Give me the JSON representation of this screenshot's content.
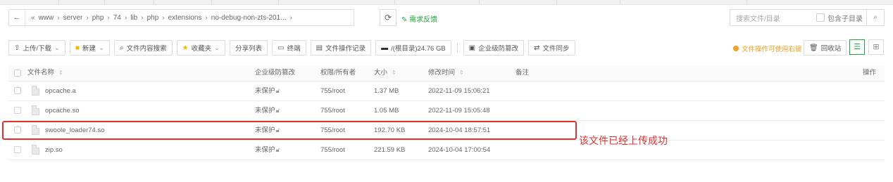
{
  "path": {
    "back_icon": "arrow-left-icon",
    "crumbs": [
      "«",
      "www",
      "server",
      "php",
      "74",
      "lib",
      "php",
      "extensions",
      "no-debug-non-zts-201..."
    ],
    "refresh_icon": "refresh-icon",
    "feedback_label": "需求反馈"
  },
  "search": {
    "placeholder": "搜索文件/目录",
    "include_subdir_label": "包含子目录"
  },
  "toolbar": {
    "upload_label": "上传/下载",
    "new_label": "新建",
    "content_search_label": "文件内容搜索",
    "favorites_label": "收藏夹",
    "share_list_label": "分享列表",
    "terminal_label": "终端",
    "op_log_label": "文件操作记录",
    "disk_label": "/(根目录)24.76 GB",
    "tamper_label": "企业级防篡改",
    "sync_label": "文件同步",
    "hint_label": "文件操作可使用右键",
    "recycle_label": "回收站"
  },
  "table": {
    "headers": {
      "name": "文件名称",
      "protect": "企业级防篡改",
      "perm": "权限/所有者",
      "size": "大小",
      "mtime": "修改时间",
      "note": "备注",
      "ops": "操作"
    },
    "rows": [
      {
        "name": "opcache.a",
        "protect": "未保护",
        "perm": "755/root",
        "size": "1.37 MB",
        "mtime": "2022-11-09 15:06:21"
      },
      {
        "name": "opcache.so",
        "protect": "未保护",
        "perm": "755/root",
        "size": "1.05 MB",
        "mtime": "2022-11-09 15:05:48"
      },
      {
        "name": "swoole_loader74.so",
        "protect": "未保护",
        "perm": "755/root",
        "size": "192.70 KB",
        "mtime": "2024-10-04 18:57:51"
      },
      {
        "name": "zip.so",
        "protect": "未保护",
        "perm": "755/root",
        "size": "221.59 KB",
        "mtime": "2024-10-04 17:00:54"
      }
    ]
  },
  "annotation": {
    "text": "该文件已经上传成功",
    "color": "#e03030"
  },
  "colors": {
    "accent": "#20a53a",
    "warning": "#f0a020"
  }
}
